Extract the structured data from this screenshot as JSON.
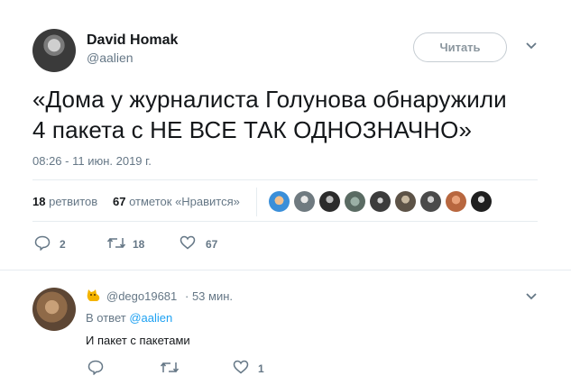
{
  "author": {
    "name": "David Homak",
    "handle": "@aalien"
  },
  "follow_label": "Читать",
  "tweet": {
    "line1": "«Дома у журналиста Голунова обнаружили",
    "line2": "4 пакета с НЕ ВСЕ ТАК ОДНОЗНАЧНО»",
    "timestamp": "08:26 - 11 июн. 2019 г."
  },
  "stats": {
    "retweets_count": "18",
    "retweets_label": "ретвитов",
    "likes_count": "67",
    "likes_label": "отметок «Нравится»"
  },
  "actions": {
    "replies": "2",
    "retweets": "18",
    "likes": "67"
  },
  "reply": {
    "handle": "@dego19681",
    "time": "· 53 мин.",
    "in_reply_prefix": "В ответ",
    "in_reply_handle": "@aalien",
    "text": "И пакет с пакетами",
    "likes": "1"
  },
  "colors": {
    "accent": "#1da1f2",
    "muted": "#657786",
    "divider": "#e6ecf0"
  },
  "icons": [
    "chevron-down-icon",
    "reply-icon",
    "retweet-icon",
    "like-icon",
    "cat-emoji-icon"
  ]
}
